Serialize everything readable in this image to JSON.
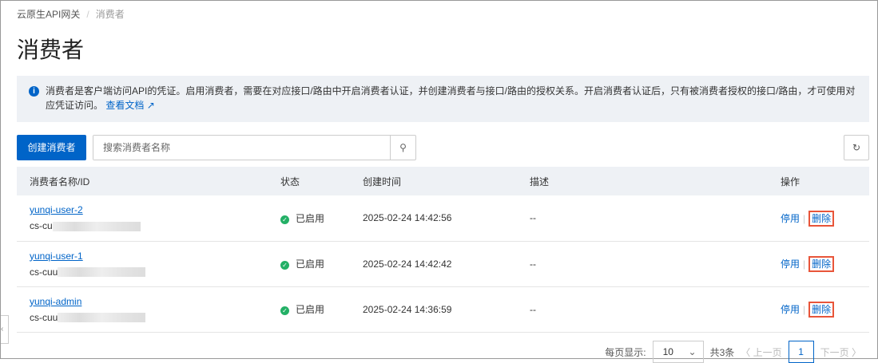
{
  "breadcrumb": [
    "云原生API网关",
    "消费者"
  ],
  "title": "消费者",
  "info": {
    "text": "消费者是客户端访问API的凭证。启用消费者，需要在对应接口/路由中开启消费者认证，并创建消费者与接口/路由的授权关系。开启消费者认证后，只有被消费者授权的接口/路由，才可使用对应凭证访问。",
    "link": "查看文档"
  },
  "create_button": "创建消费者",
  "search_placeholder": "搜索消费者名称",
  "columns": [
    "消费者名称/ID",
    "状态",
    "创建时间",
    "描述",
    "操作"
  ],
  "rows": [
    {
      "name": "yunqi-user-2",
      "id": "cs-cu",
      "status": "已启用",
      "created": "2025-02-24 14:42:56",
      "desc": "--",
      "disable": "停用",
      "delete": "删除"
    },
    {
      "name": "yunqi-user-1",
      "id": "cs-cuu",
      "status": "已启用",
      "created": "2025-02-24 14:42:42",
      "desc": "--",
      "disable": "停用",
      "delete": "删除"
    },
    {
      "name": "yunqi-admin",
      "id": "cs-cuu",
      "status": "已启用",
      "created": "2025-02-24 14:36:59",
      "desc": "--",
      "disable": "停用",
      "delete": "删除"
    }
  ],
  "pagination": {
    "per_page_label": "每页显示:",
    "per_page": "10",
    "total": "共3条",
    "prev": "上一页",
    "page": "1",
    "next": "下一页"
  },
  "colors": {
    "primary": "#0064c8",
    "success": "#23b066",
    "highlight": "#e8553a"
  }
}
